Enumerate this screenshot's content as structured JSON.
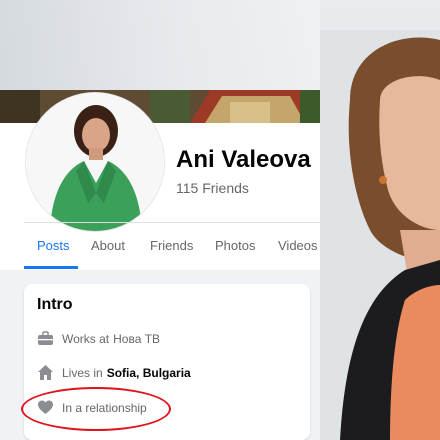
{
  "profile": {
    "name": "Ani Valeova",
    "friends": "115 Friends"
  },
  "tabs": [
    {
      "label": "Posts",
      "active": true
    },
    {
      "label": "About",
      "active": false
    },
    {
      "label": "Friends",
      "active": false
    },
    {
      "label": "Photos",
      "active": false
    },
    {
      "label": "Videos",
      "active": false
    }
  ],
  "intro": {
    "title": "Intro",
    "work": {
      "prefix": "Works at",
      "place": "Нова ТВ",
      "icon": "briefcase-icon"
    },
    "lives": {
      "prefix": "Lives in",
      "place": "Sofia, Bulgaria",
      "icon": "house-icon"
    },
    "relationship": {
      "text": "In a relationship",
      "icon": "heart-icon"
    }
  },
  "colors": {
    "accent": "#1877f2",
    "highlight": "#e0121b",
    "jacket": "#3aa05a"
  }
}
